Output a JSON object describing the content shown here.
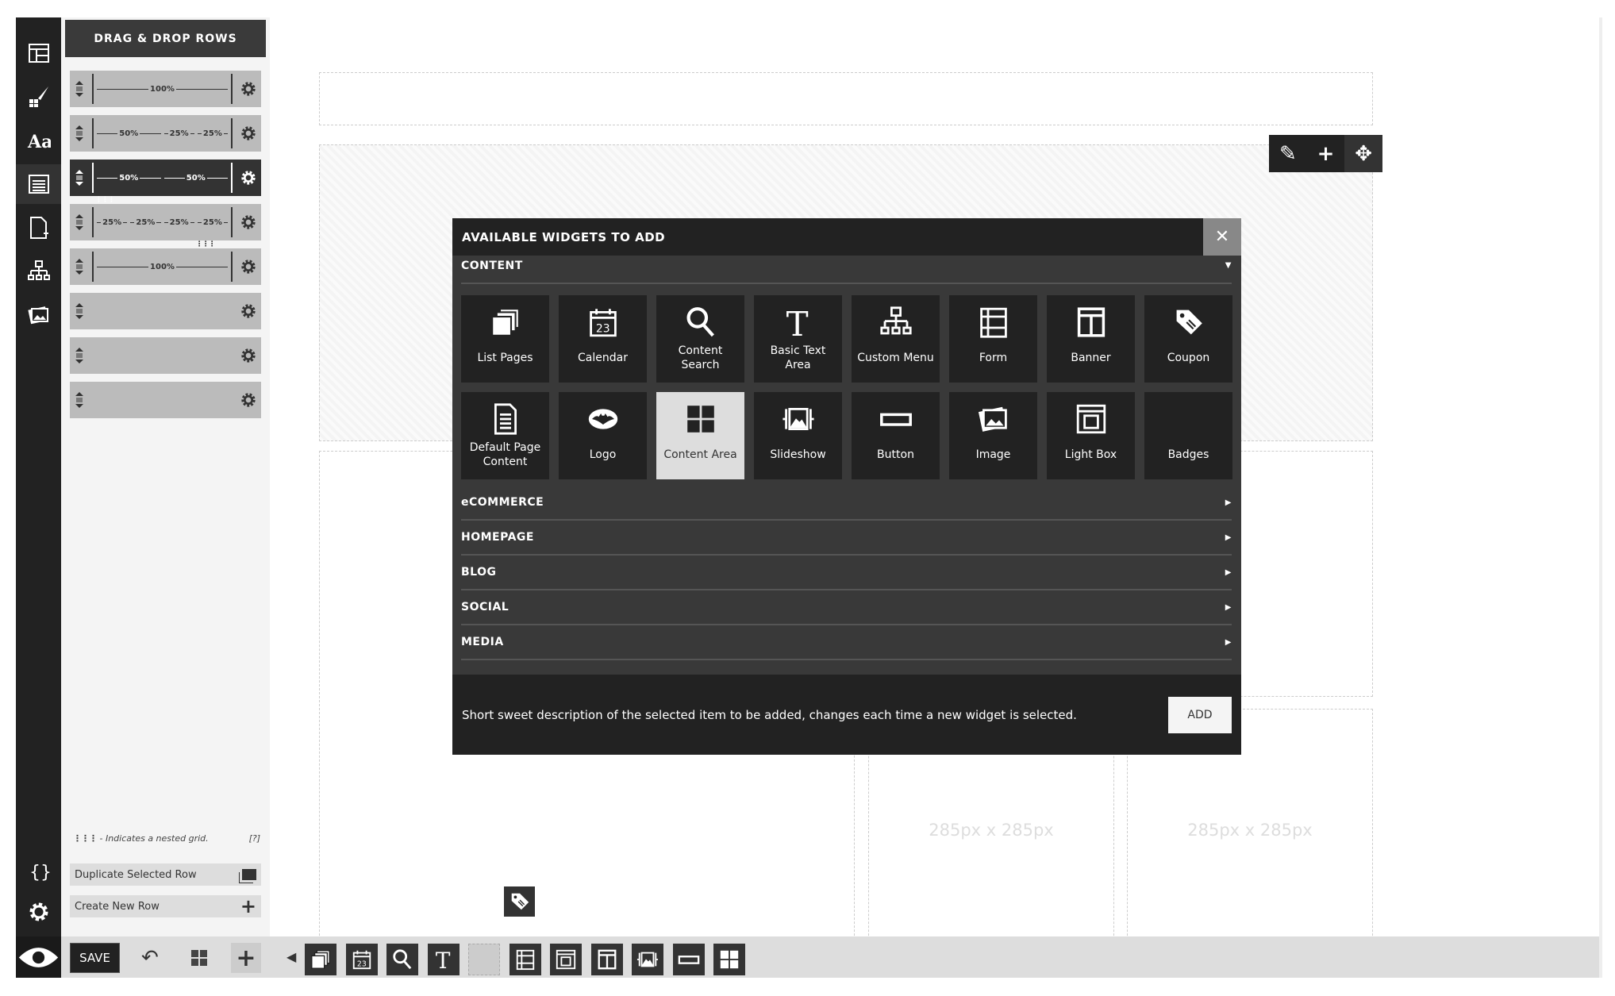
{
  "iconbar": {
    "top": [
      "layout-icon",
      "brush-icon",
      "typography-icon",
      "rows-icon",
      "add-page-icon",
      "sitemap-icon",
      "images-icon"
    ],
    "active": 3,
    "bottom": [
      "code-icon",
      "gear-icon"
    ],
    "preview": "eye-icon"
  },
  "panel": {
    "title": "DRAG & DROP ROWS",
    "rows": [
      {
        "columns": [
          "100%"
        ],
        "selected": false,
        "nested_col": null
      },
      {
        "columns": [
          "50%",
          "25%",
          "25%"
        ],
        "selected": false,
        "nested_col": null
      },
      {
        "columns": [
          "50%",
          "50%"
        ],
        "selected": true,
        "nested_col": 0
      },
      {
        "columns": [
          "25%",
          "25%",
          "25%",
          "25%"
        ],
        "selected": false,
        "nested_col": 3
      },
      {
        "columns": [
          "100%"
        ],
        "selected": false,
        "nested_col": null
      },
      {
        "columns": [],
        "selected": false,
        "nested_col": null
      },
      {
        "columns": [],
        "selected": false,
        "nested_col": null
      },
      {
        "columns": [],
        "selected": false,
        "nested_col": null
      }
    ],
    "legend_text": "- Indicates a nested grid.",
    "legend_help": "[?]",
    "duplicate_label": "Duplicate Selected Row",
    "create_label": "Create New Row"
  },
  "canvas": {
    "placeholder": "285px x 285px",
    "partial_placeholder": "x 285px"
  },
  "modal": {
    "title": "AVAILABLE WIDGETS TO ADD",
    "content_label": "CONTENT",
    "widgets": [
      {
        "label": "List Pages",
        "icon": "pages-icon"
      },
      {
        "label": "Calendar",
        "icon": "calendar-icon"
      },
      {
        "label": "Content Search",
        "icon": "search-icon"
      },
      {
        "label": "Basic Text Area",
        "icon": "text-icon"
      },
      {
        "label": "Custom Menu",
        "icon": "sitemap-icon"
      },
      {
        "label": "Form",
        "icon": "form-icon"
      },
      {
        "label": "Banner",
        "icon": "banner-icon"
      },
      {
        "label": "Coupon",
        "icon": "tag-icon"
      },
      {
        "label": "Default Page Content",
        "icon": "document-icon"
      },
      {
        "label": "Logo",
        "icon": "logo-icon"
      },
      {
        "label": "Content Area",
        "icon": "grid-icon"
      },
      {
        "label": "Slideshow",
        "icon": "slideshow-icon"
      },
      {
        "label": "Button",
        "icon": "button-icon"
      },
      {
        "label": "Image",
        "icon": "images-icon"
      },
      {
        "label": "Light Box",
        "icon": "lightbox-icon"
      },
      {
        "label": "Badges",
        "icon": ""
      }
    ],
    "selected_widget": 10,
    "categories": [
      "eCOMMERCE",
      "HOMEPAGE",
      "BLOG",
      "SOCIAL",
      "MEDIA"
    ],
    "description": "Short sweet description of the selected item to be added, changes each time a new widget is selected.",
    "add_label": "ADD"
  },
  "bottombar": {
    "save_label": "SAVE",
    "tools": [
      "pages-icon",
      "calendar-icon",
      "search-icon",
      "text-icon",
      "",
      "form-icon",
      "lightbox-icon",
      "banner-icon",
      "slideshow-icon",
      "button-icon",
      "grid-icon"
    ]
  }
}
